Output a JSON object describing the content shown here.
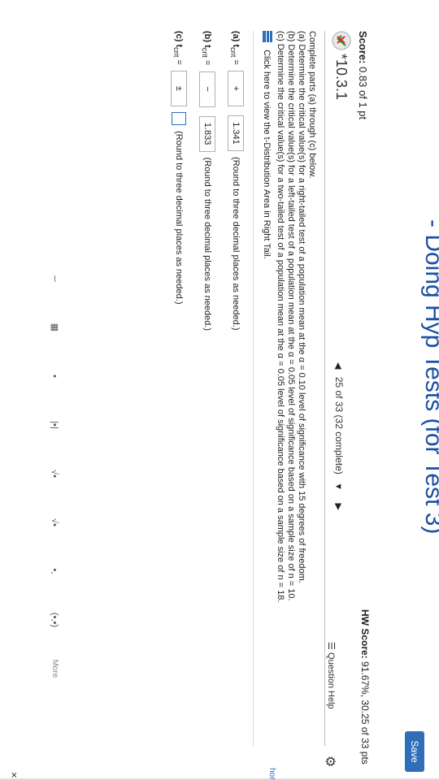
{
  "header": {
    "title": "- Doing Hyp Tests (for Test 3)",
    "save_label": "Save"
  },
  "score": {
    "label": "Score:",
    "value": "0.83 of 1 pt"
  },
  "hw_score": {
    "label": "HW Score:",
    "value": "91.67%, 30.25 of 33 pts"
  },
  "question": {
    "number": "*10.3.1",
    "nav_text": "25 of 33 (32 complete)",
    "help_label": "Question Help"
  },
  "prompt": {
    "intro": "Complete parts (a) through (c) below.",
    "part_a": "(a) Determine the critical value(s) for a right-tailed test of a population mean at the α = 0.10 level of significance with 15 degrees of freedom.",
    "part_b": "(b) Determine the critical value(s) for a left-tailed test of a population mean at the α = 0.05 level of significance based on a sample size of n = 10.",
    "part_c": "(c) Determine the critical value(s) for a two-tailed test of a population mean at the α = 0.05 level of significance based on a sample size of n = 18.",
    "dist_link": "Click here to view the t-Distribution Area in Right Tail."
  },
  "answers": {
    "a": {
      "label": "(a) t",
      "sub": "crit",
      "eq": "=",
      "sign": "+",
      "value": "1.341",
      "note": "(Round to three decimal places as needed.)"
    },
    "b": {
      "label": "(b) t",
      "sub": "crit",
      "eq": "=",
      "sign": "−",
      "value": "1.833",
      "note": "(Round to three decimal places as needed.)"
    },
    "c": {
      "label": "(c) t",
      "sub": "crit",
      "eq": "=",
      "sign": "±",
      "value": "",
      "note": "(Round to three decimal places as needed.)"
    }
  },
  "toolbar": {
    "tools": [
      "─",
      "▦",
      "▪",
      "|▪|",
      "√▪",
      "√▪",
      "▪,",
      "(▪,▪)"
    ],
    "more_label": "More"
  },
  "close_label": "×",
  "side_tab": "home"
}
